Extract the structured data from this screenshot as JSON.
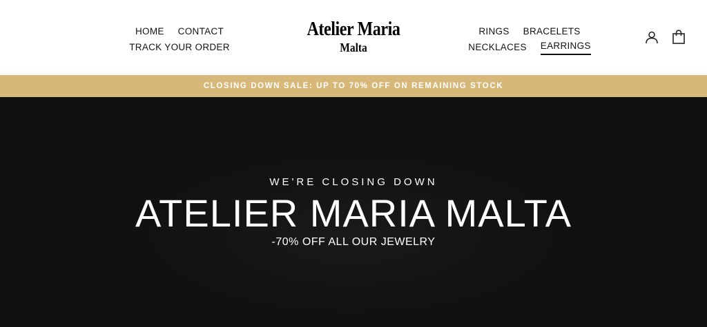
{
  "header": {
    "logo": {
      "line1": "Atelier Maria",
      "line2": "Malta"
    },
    "nav_left": [
      {
        "label": "HOME"
      },
      {
        "label": "CONTACT"
      },
      {
        "label": "TRACK YOUR ORDER"
      }
    ],
    "nav_right": [
      {
        "label": "RINGS"
      },
      {
        "label": "BRACELETS"
      },
      {
        "label": "NECKLACES"
      },
      {
        "label": "EARRINGS",
        "active": true
      }
    ],
    "icons": {
      "account": "user-icon",
      "cart": "shopping-bag-icon"
    }
  },
  "announcement": {
    "text": "CLOSING DOWN SALE: UP TO 70% OFF ON REMAINING STOCK"
  },
  "hero": {
    "kicker": "WE'RE CLOSING DOWN",
    "title": "ATELIER MARIA MALTA",
    "subtitle": "-70% OFF ALL OUR JEWELRY"
  },
  "colors": {
    "announcement_bg": "#d7b879",
    "hero_bg": "#111111",
    "text_dark": "#111111"
  }
}
